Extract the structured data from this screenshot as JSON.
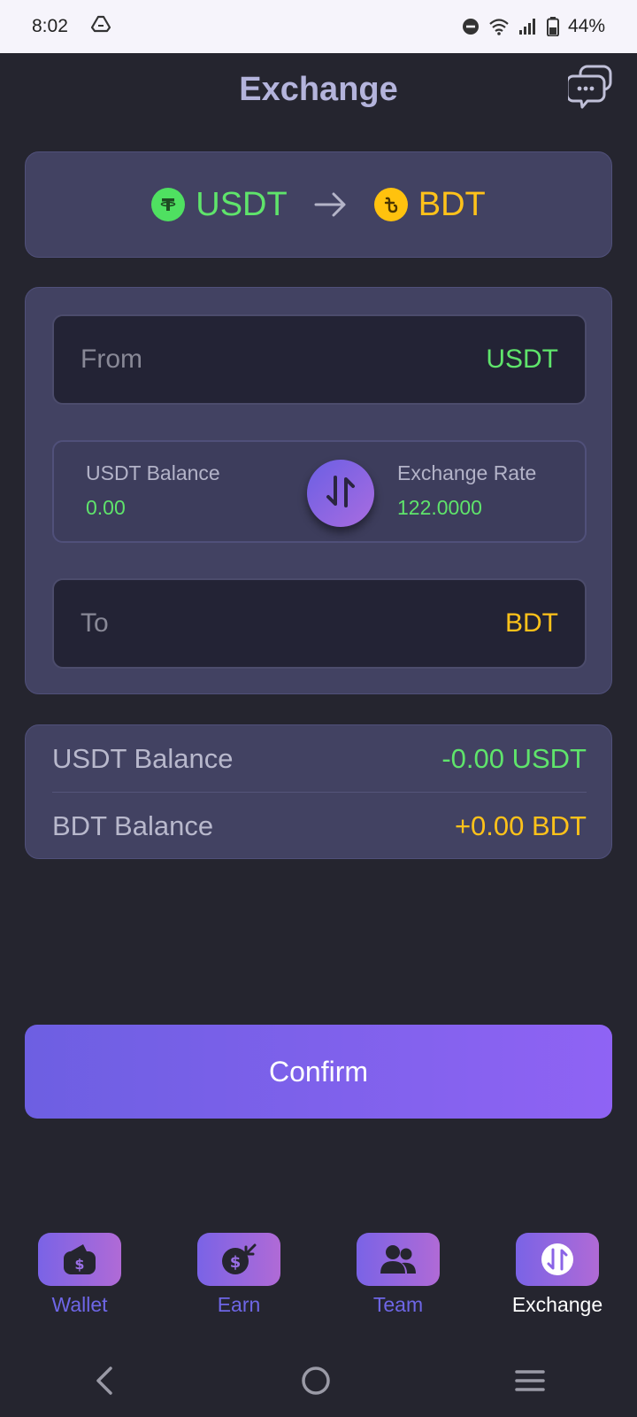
{
  "status_bar": {
    "time": "8:02",
    "battery_percent": "44%",
    "icons": [
      "drive-icon",
      "dnd-icon",
      "wifi-icon",
      "signal-icon",
      "battery-icon"
    ]
  },
  "header": {
    "title": "Exchange",
    "chat_icon": "chat-bubbles-icon"
  },
  "pair": {
    "from_code": "USDT",
    "to_code": "BDT",
    "from_icon": "tether-coin-icon",
    "to_icon": "taka-coin-icon"
  },
  "exchange_form": {
    "from": {
      "label": "From",
      "currency": "USDT"
    },
    "to": {
      "label": "To",
      "currency": "BDT"
    },
    "balance_label": "USDT Balance",
    "balance_value": "0.00",
    "rate_label": "Exchange Rate",
    "rate_value": "122.0000",
    "swap_icon": "swap-arrows-icon"
  },
  "balances": [
    {
      "label": "USDT Balance",
      "value": "-0.00 USDT"
    },
    {
      "label": "BDT Balance",
      "value": "+0.00 BDT"
    }
  ],
  "confirm_label": "Confirm",
  "bottom_nav": [
    {
      "label": "Wallet",
      "icon": "wallet-icon"
    },
    {
      "label": "Earn",
      "icon": "money-bag-icon"
    },
    {
      "label": "Team",
      "icon": "team-icon"
    },
    {
      "label": "Exchange",
      "icon": "exchange-icon",
      "active": true
    }
  ],
  "colors": {
    "background": "#25252f",
    "card": "#424262",
    "green": "#5fe46b",
    "yellow": "#ffc21a",
    "accent": "#8f63f4",
    "nav_inactive": "#6e66e6"
  }
}
